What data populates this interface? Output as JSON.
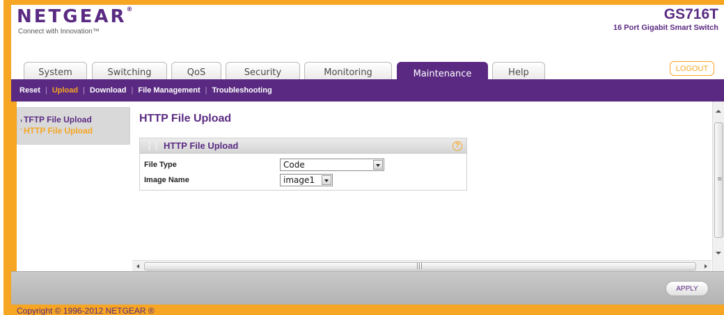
{
  "brand": {
    "logo": "NETGEAR",
    "tagline": "Connect with Innovation™",
    "model": "GS716T",
    "model_description": "16 Port Gigabit Smart Switch"
  },
  "tabs": [
    {
      "label": "System",
      "active": false
    },
    {
      "label": "Switching",
      "active": false
    },
    {
      "label": "QoS",
      "active": false
    },
    {
      "label": "Security",
      "active": false
    },
    {
      "label": "Monitoring",
      "active": false
    },
    {
      "label": "Maintenance",
      "active": true
    },
    {
      "label": "Help",
      "active": false
    }
  ],
  "logout_label": "LOGOUT",
  "subnav": [
    {
      "label": "Reset",
      "active": false
    },
    {
      "label": "Upload",
      "active": true
    },
    {
      "label": "Download",
      "active": false
    },
    {
      "label": "File Management",
      "active": false
    },
    {
      "label": "Troubleshooting",
      "active": false
    }
  ],
  "leftnav": [
    {
      "label": "TFTP File Upload",
      "active": false
    },
    {
      "label": "HTTP File Upload",
      "active": true
    }
  ],
  "page_title": "HTTP File Upload",
  "panel": {
    "title": "HTTP File Upload",
    "fields": [
      {
        "label": "File Type",
        "value": "Code"
      },
      {
        "label": "Image Name",
        "value": "image1"
      }
    ]
  },
  "apply_label": "APPLY",
  "copyright": "Copyright © 1996-2012 NETGEAR ®",
  "colors": {
    "brand_purple": "#5a2a82",
    "accent_orange": "#f6a623"
  }
}
